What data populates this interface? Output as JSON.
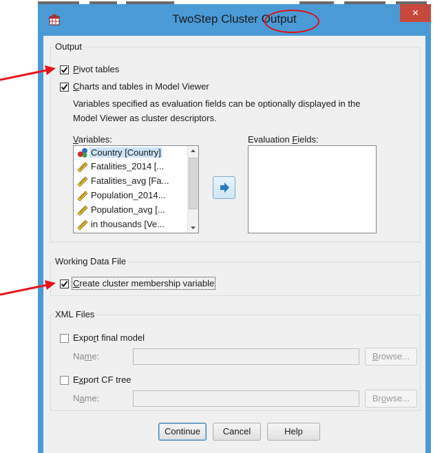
{
  "window": {
    "title": "TwoStep Cluster Output",
    "close_label": "×"
  },
  "output_group": {
    "label": "Output",
    "pivot_tables": {
      "label": "Pivot tables",
      "checked": true
    },
    "charts_tables": {
      "label": "Charts and tables in Model Viewer",
      "checked": true
    },
    "description_line1": "Variables specified as evaluation fields can be optionally displayed in the",
    "description_line2": "Model Viewer as cluster descriptors.",
    "variables_label": "Variables:",
    "variables": [
      {
        "name": "Country [Country]",
        "icon": "nominal-variable-icon"
      },
      {
        "name": "Fatalities_2014 [...",
        "icon": "scale-variable-icon"
      },
      {
        "name": "Fatalities_avg [Fa...",
        "icon": "scale-variable-icon"
      },
      {
        "name": "Population_2014...",
        "icon": "scale-variable-icon"
      },
      {
        "name": "Population_avg [...",
        "icon": "scale-variable-icon"
      },
      {
        "name": "in thousands [Ve...",
        "icon": "scale-variable-icon"
      }
    ],
    "evaluation_fields_label": "Evaluation Fields:"
  },
  "working_data_group": {
    "label": "Working Data File",
    "create_membership": {
      "label": "Create cluster membership variable",
      "checked": true
    }
  },
  "xml_group": {
    "label": "XML Files",
    "export_final": {
      "label": "Export final model",
      "checked": false
    },
    "export_cf": {
      "label": "Export CF tree",
      "checked": false
    },
    "name_label": "Name:",
    "browse_label": "Browse..."
  },
  "buttons": {
    "continue": "Continue",
    "cancel": "Cancel",
    "help": "Help"
  },
  "colors": {
    "title_bar": "#4a9ad6",
    "close_button": "#c7493d",
    "annotation_red": "#e8141b"
  }
}
